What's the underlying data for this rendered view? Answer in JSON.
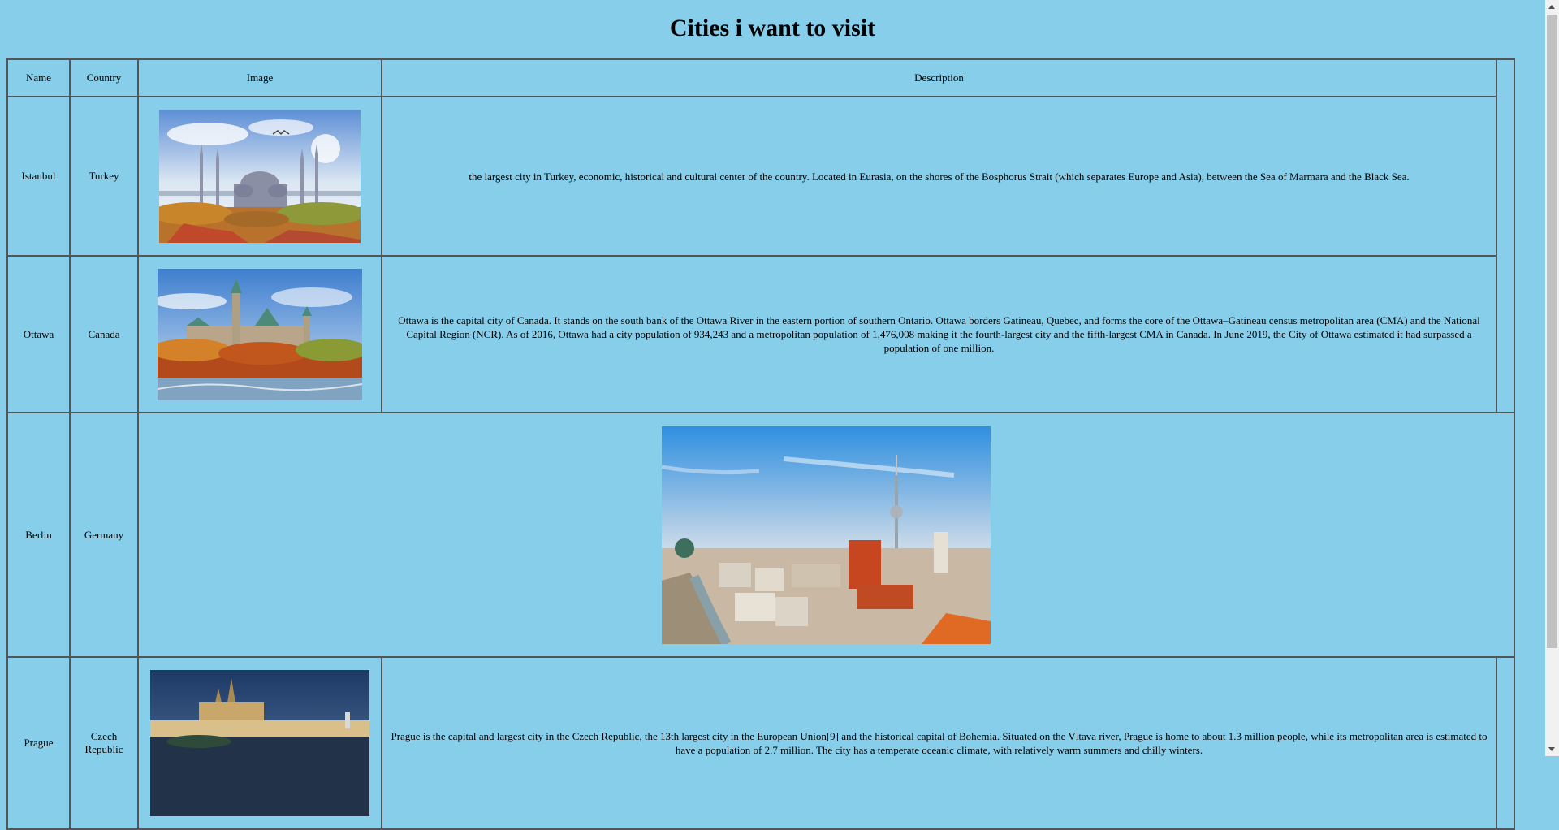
{
  "page": {
    "title": "Cities i want to visit"
  },
  "table": {
    "headers": {
      "name": "Name",
      "country": "Country",
      "image": "Image",
      "description": "Description"
    },
    "rows": [
      {
        "name": "Istanbul",
        "country": "Turkey",
        "image_alt": "Istanbul",
        "description": "the largest city in Turkey, economic, historical and cultural center of the country. Located in Eurasia, on the shores of the Bosphorus Strait (which separates Europe and Asia), between the Sea of Marmara and the Black Sea."
      },
      {
        "name": "Ottawa",
        "country": "Canada",
        "image_alt": "Ottawa",
        "description": "Ottawa is the capital city of Canada. It stands on the south bank of the Ottawa River in the eastern portion of southern Ontario. Ottawa borders Gatineau, Quebec, and forms the core of the Ottawa–Gatineau census metropolitan area (CMA) and the National Capital Region (NCR). As of 2016, Ottawa had a city population of 934,243 and a metropolitan population of 1,476,008 making it the fourth-largest city and the fifth-largest CMA in Canada. In June 2019, the City of Ottawa estimated it had surpassed a population of one million."
      },
      {
        "name": "Berlin",
        "country": "Germany",
        "image_alt": "Berlin"
      },
      {
        "name": "Prague",
        "country": "Czech Republic",
        "image_alt": "Prague",
        "description": "Prague is the capital and largest city in the Czech Republic, the 13th largest city in the European Union[9] and the historical capital of Bohemia. Situated on the Vltava river, Prague is home to about 1.3 million people, while its metropolitan area is estimated to have a population of 2.7 million. The city has a temperate oceanic climate, with relatively warm summers and chilly winters."
      }
    ]
  },
  "colors": {
    "background": "#87ceeb",
    "border": "#555555"
  }
}
